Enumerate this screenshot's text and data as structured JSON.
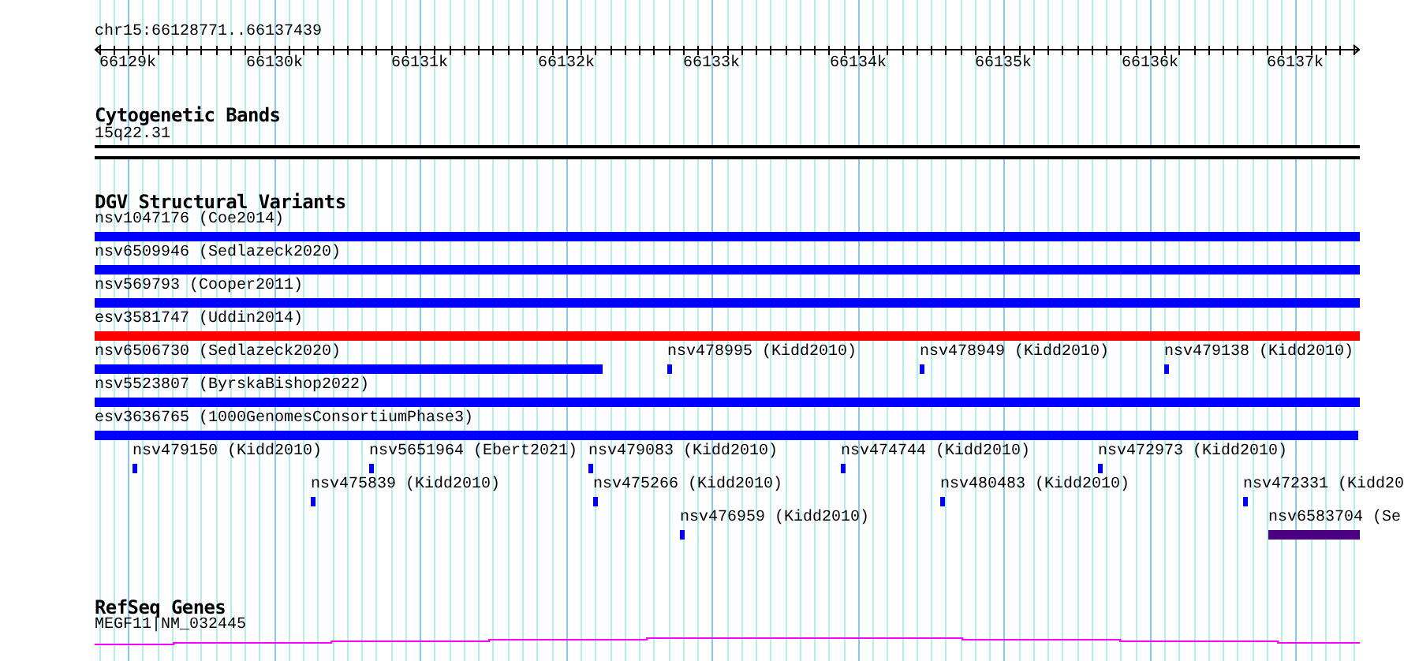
{
  "ruler": {
    "title": "chr15:66128771..66137439",
    "ticks": [
      "66129k",
      "66130k",
      "66131k",
      "66132k",
      "66133k",
      "66134k",
      "66135k",
      "66136k",
      "66137k"
    ]
  },
  "tracks": [
    {
      "kind": "bands",
      "title": "Cytogenetic Bands",
      "label": "15q22.31"
    },
    {
      "kind": "variants",
      "title": "DGV Structural Variants",
      "features": [
        {
          "label": "nsv1047176 (Coe2014)",
          "color": "#0000ff"
        },
        {
          "label": "nsv6509946 (Sedlazeck2020)",
          "color": "#0000ff"
        },
        {
          "label": "nsv569793 (Cooper2011)",
          "color": "#0000ff"
        },
        {
          "label": "esv3581747 (Uddin2014)",
          "color": "#ff0000"
        },
        {
          "label": "nsv6506730 (Sedlazeck2020)",
          "color": "#0000ff"
        },
        {
          "label": "nsv478995 (Kidd2010)",
          "color": "#0000ff"
        },
        {
          "label": "nsv478949 (Kidd2010)",
          "color": "#0000ff"
        },
        {
          "label": "nsv479138 (Kidd2010)",
          "color": "#0000ff"
        },
        {
          "label": "nsv5523807 (ByrskaBishop2022)",
          "color": "#0000ff"
        },
        {
          "label": "esv3636765 (1000GenomesConsortiumPhase3)",
          "color": "#0000ff"
        },
        {
          "label": "nsv479150 (Kidd2010)",
          "color": "#0000ff"
        },
        {
          "label": "nsv5651964 (Ebert2021)",
          "color": "#0000ff"
        },
        {
          "label": "nsv479083 (Kidd2010)",
          "color": "#0000ff"
        },
        {
          "label": "nsv474744 (Kidd2010)",
          "color": "#0000ff"
        },
        {
          "label": "nsv472973 (Kidd2010)",
          "color": "#0000ff"
        },
        {
          "label": "nsv475839 (Kidd2010)",
          "color": "#0000ff"
        },
        {
          "label": "nsv475266 (Kidd2010)",
          "color": "#0000ff"
        },
        {
          "label": "nsv480483 (Kidd2010)",
          "color": "#0000ff"
        },
        {
          "label": "nsv472331 (Kidd20",
          "color": "#0000ff"
        },
        {
          "label": "nsv476959 (Kidd2010)",
          "color": "#0000ff"
        },
        {
          "label": "nsv6583704 (Se",
          "color": "#4b0082"
        }
      ]
    },
    {
      "kind": "genes",
      "title": "RefSeq Genes",
      "label": "MEGF11|NM_032445"
    }
  ]
}
